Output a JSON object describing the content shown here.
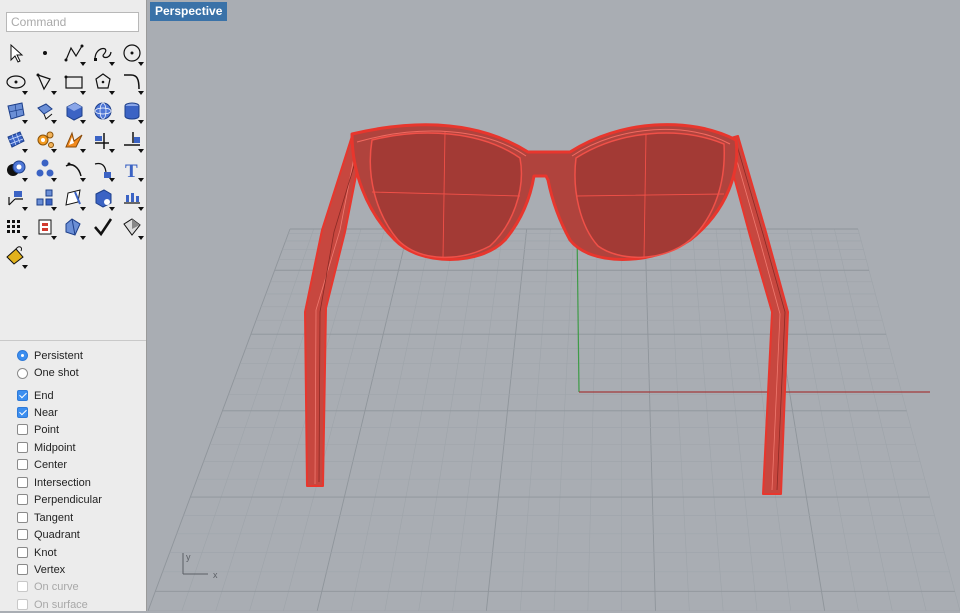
{
  "command": {
    "placeholder": "Command"
  },
  "viewport": {
    "label": "Perspective"
  },
  "axes": {
    "x": "x",
    "y": "y"
  },
  "colors": {
    "selection_red": "#e8362d",
    "grid": "#9aa0a6",
    "x_axis": "#a33b3b",
    "y_axis": "#3e9b47",
    "viewport_bg": "#a9adb3",
    "active_tab": "#3a72a8"
  },
  "tools": [
    "select-arrow-icon",
    "point-icon",
    "polyline-icon",
    "curve-icon",
    "circle-icon",
    "ellipse-icon",
    "polygon-curve-icon",
    "rectangle-icon",
    "polygon-icon",
    "fillet-curve-icon",
    "surface-icon",
    "extrude-icon",
    "box-icon",
    "sphere-icon",
    "cylinder-icon",
    "mesh-icon",
    "gear-icon",
    "explode-icon",
    "trim-icon",
    "split-icon",
    "boolean-icon",
    "group-icon",
    "curve-tool-icon",
    "transform-icon",
    "text-icon",
    "dimension-icon",
    "array-icon",
    "edit-icon",
    "solid-tools-icon",
    "align-icon",
    "grid-icon",
    "history-icon",
    "analyze-icon",
    "check-icon",
    "render-icon",
    "paint-icon"
  ],
  "osnap": {
    "modes": [
      {
        "label": "Persistent",
        "selected": true
      },
      {
        "label": "One shot",
        "selected": false
      }
    ],
    "snaps": [
      {
        "label": "End",
        "checked": true,
        "enabled": true
      },
      {
        "label": "Near",
        "checked": true,
        "enabled": true
      },
      {
        "label": "Point",
        "checked": false,
        "enabled": true
      },
      {
        "label": "Midpoint",
        "checked": false,
        "enabled": true
      },
      {
        "label": "Center",
        "checked": false,
        "enabled": true
      },
      {
        "label": "Intersection",
        "checked": false,
        "enabled": true
      },
      {
        "label": "Perpendicular",
        "checked": false,
        "enabled": true
      },
      {
        "label": "Tangent",
        "checked": false,
        "enabled": true
      },
      {
        "label": "Quadrant",
        "checked": false,
        "enabled": true
      },
      {
        "label": "Knot",
        "checked": false,
        "enabled": true
      },
      {
        "label": "Vertex",
        "checked": false,
        "enabled": true
      },
      {
        "label": "On curve",
        "checked": false,
        "enabled": false
      },
      {
        "label": "On surface",
        "checked": false,
        "enabled": false
      }
    ]
  }
}
